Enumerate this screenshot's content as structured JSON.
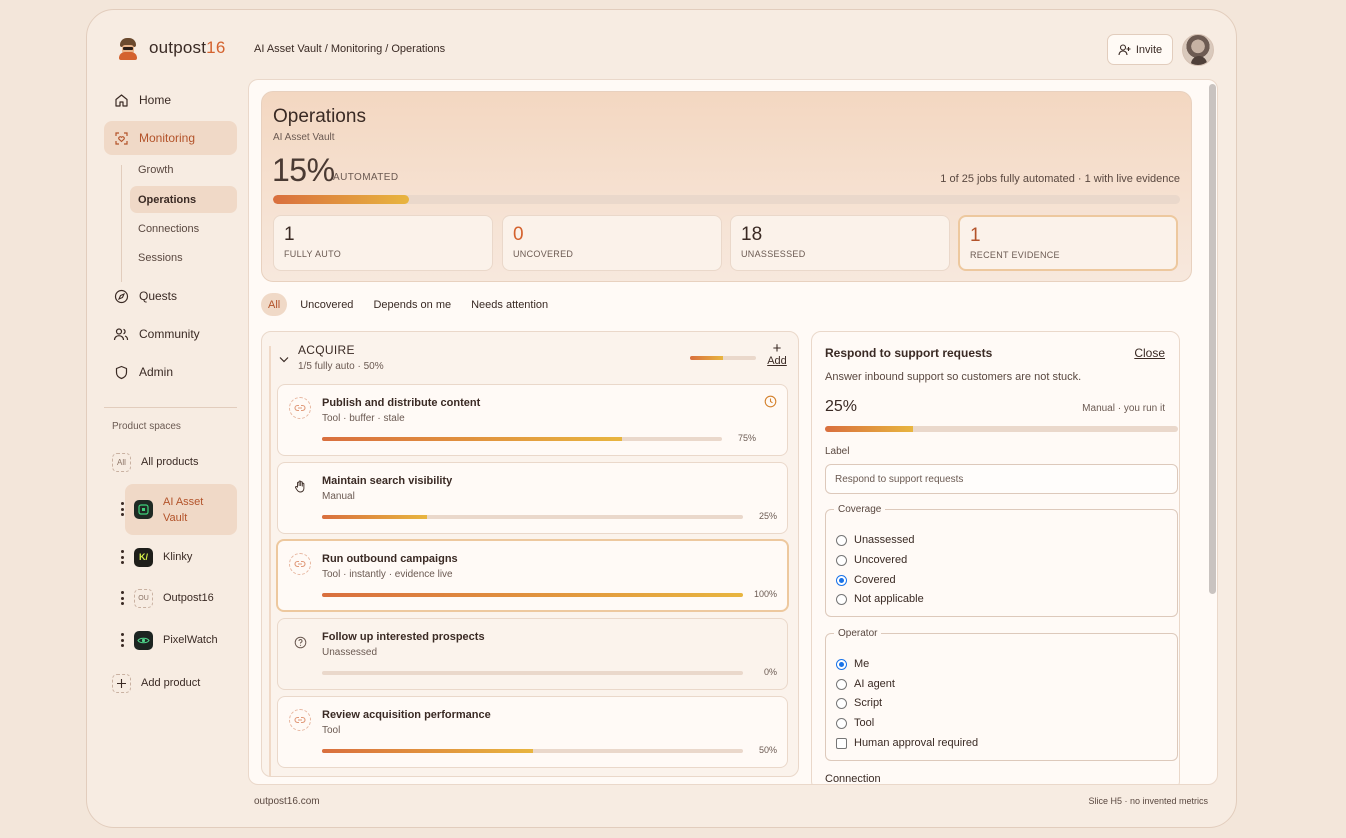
{
  "app": {
    "name_prefix": "outpost",
    "name_num": "16"
  },
  "breadcrumb": "AI Asset Vault / Monitoring / Operations",
  "header": {
    "invite_label": "Invite"
  },
  "nav": {
    "home": "Home",
    "monitoring": "Monitoring",
    "sub": [
      "Growth",
      "Operations",
      "Connections",
      "Sessions"
    ],
    "quests": "Quests",
    "community": "Community",
    "admin": "Admin"
  },
  "products": {
    "section_label": "Product spaces",
    "all_badge": "All",
    "all": "All products",
    "items": [
      {
        "name": "AI Asset Vault",
        "icon": "vault-icon"
      },
      {
        "name": "Klinky",
        "icon_text": "K/"
      },
      {
        "name": "Outpost16",
        "icon_text": "OU"
      },
      {
        "name": "PixelWatch",
        "icon": "eye-icon"
      }
    ],
    "add": "Add product"
  },
  "hero": {
    "title": "Operations",
    "subtitle": "AI Asset Vault",
    "percent": "15%",
    "percent_value": 15,
    "automated_label": "AUTOMATED",
    "summary": "1 of 25 jobs fully automated · 1 with live evidence",
    "stats": [
      {
        "value": "1",
        "label": "FULLY AUTO"
      },
      {
        "value": "0",
        "label": "UNCOVERED"
      },
      {
        "value": "18",
        "label": "UNASSESSED"
      },
      {
        "value": "1",
        "label": "RECENT EVIDENCE"
      }
    ]
  },
  "filters": [
    "All",
    "Uncovered",
    "Depends on me",
    "Needs attention"
  ],
  "stage": {
    "name": "ACQUIRE",
    "meta": "1/5 fully auto · 50%",
    "progress": 50,
    "add_label": "Add",
    "jobs": [
      {
        "title": "Publish and distribute content",
        "sub": "Tool · buffer · stale",
        "pct": "75%",
        "value": 75,
        "icon": "link-icon"
      },
      {
        "title": "Maintain search visibility",
        "sub": "Manual",
        "pct": "25%",
        "value": 25,
        "icon": "hand-icon"
      },
      {
        "title": "Run outbound campaigns",
        "sub": "Tool · instantly · evidence live",
        "pct": "100%",
        "value": 100,
        "icon": "link-icon"
      },
      {
        "title": "Follow up interested prospects",
        "sub": "Unassessed",
        "pct": "0%",
        "value": 0,
        "icon": "question-icon"
      },
      {
        "title": "Review acquisition performance",
        "sub": "Tool",
        "pct": "50%",
        "value": 50,
        "icon": "link-icon"
      }
    ]
  },
  "detail": {
    "title": "Respond to support requests",
    "close": "Close",
    "description": "Answer inbound support so customers are not stuck.",
    "percent": "25%",
    "value": 25,
    "mode": "Manual · you run it",
    "label_caption": "Label",
    "label_placeholder": "Respond to support requests",
    "coverage_legend": "Coverage",
    "coverage_options": [
      "Unassessed",
      "Uncovered",
      "Covered",
      "Not applicable"
    ],
    "coverage_selected": "Covered",
    "operator_legend": "Operator",
    "operator_options": [
      "Me",
      "AI agent",
      "Script",
      "Tool"
    ],
    "operator_selected": "Me",
    "approval_label": "Human approval required",
    "connection_label": "Connection"
  },
  "footer": {
    "left": "outpost16.com",
    "right": "Slice H5 · no invented metrics"
  },
  "colors": {
    "accent": "#d4622e",
    "active_bg": "#f0d9c7",
    "progress_start": "#d96f3e",
    "progress_end": "#e8b53f"
  }
}
